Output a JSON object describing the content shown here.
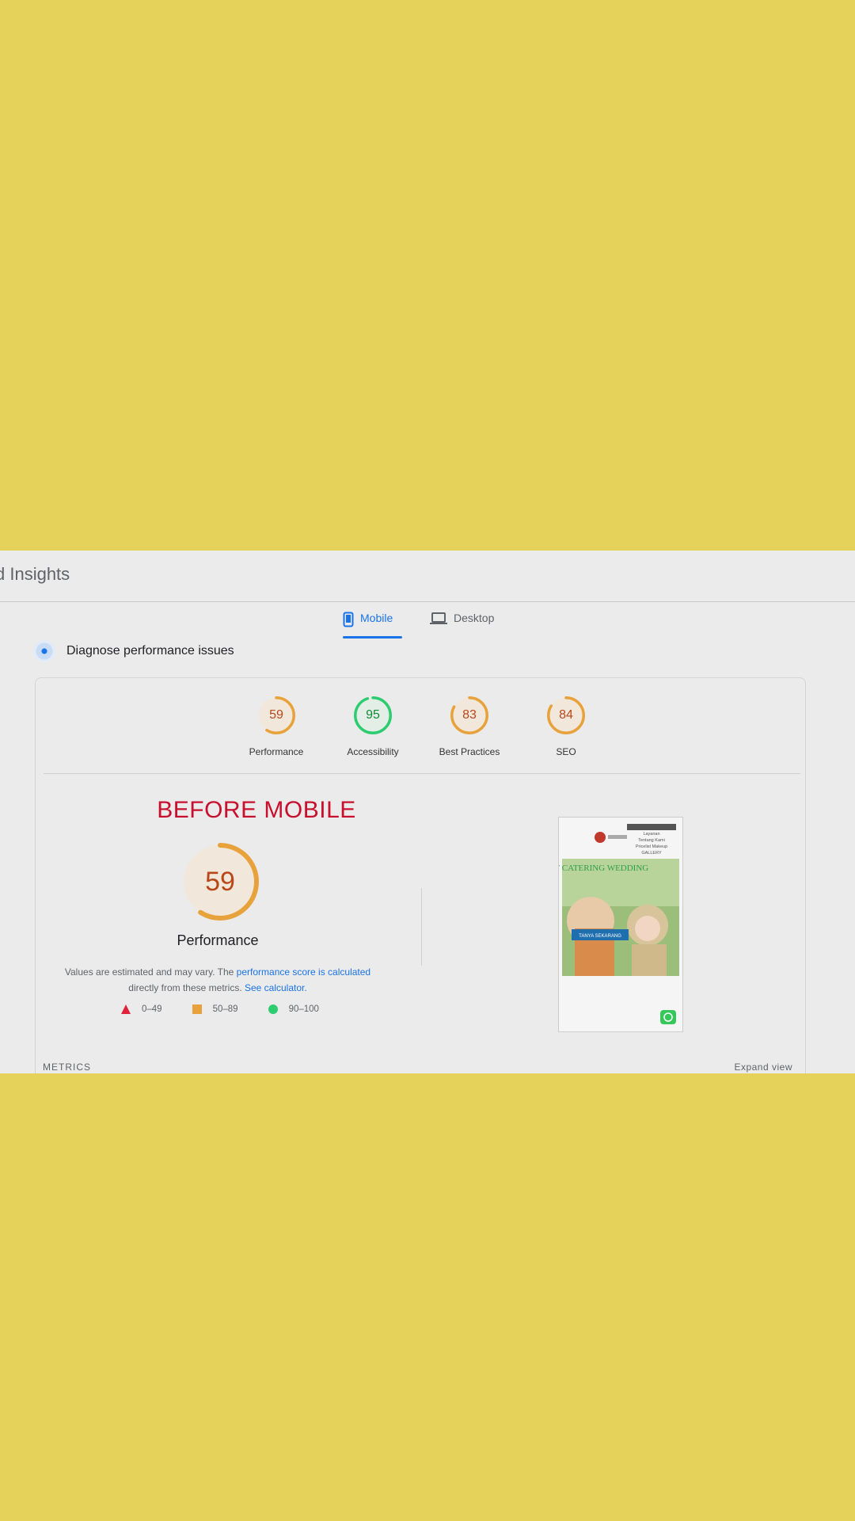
{
  "header": {
    "title": "d Insights"
  },
  "tabs": [
    {
      "label": "Mobile",
      "icon": "phone-icon",
      "active": true
    },
    {
      "label": "Desktop",
      "icon": "laptop-icon",
      "active": false
    }
  ],
  "diagnose": {
    "title": "Diagnose performance issues",
    "icon": "diagnose-icon"
  },
  "scores": [
    {
      "value": "59",
      "label": "Performance",
      "score": 59,
      "color": "#e8a23c",
      "text_color": "#b8471a"
    },
    {
      "value": "95",
      "label": "Accessibility",
      "score": 95,
      "color": "#2ecc71",
      "text_color": "#138a36"
    },
    {
      "value": "83",
      "label": "Best Practices",
      "score": 83,
      "color": "#e8a23c",
      "text_color": "#b8471a"
    },
    {
      "value": "84",
      "label": "SEO",
      "score": 84,
      "color": "#e8a23c",
      "text_color": "#b8471a"
    }
  ],
  "annotation": "BEFORE MOBILE",
  "main_score": {
    "value": "59",
    "label": "Performance",
    "score": 59
  },
  "description": {
    "part1": "Values are estimated and may vary. The ",
    "link1": "performance score is calculated",
    "part2": "directly from these metrics. ",
    "link2": "See calculator."
  },
  "legend": [
    {
      "shape": "triangle",
      "range": "0–49",
      "color": "#e0223c"
    },
    {
      "shape": "square",
      "range": "50–89",
      "color": "#e8a23c"
    },
    {
      "shape": "circle",
      "range": "90–100",
      "color": "#2ecc71"
    }
  ],
  "screenshot": {
    "menu": [
      "Layanan",
      "Tentang Kami",
      "Pricelist Makeup",
      "GALLERY"
    ],
    "hero_title": "PAKET CATERING WEDDING",
    "cta": "TANYA SEKARANG"
  },
  "metrics_label": "METRICS",
  "expand_label": "Expand view",
  "colors": {
    "accent": "#1a73e8",
    "background": "#e5d25b",
    "panel": "#ebebeb"
  }
}
